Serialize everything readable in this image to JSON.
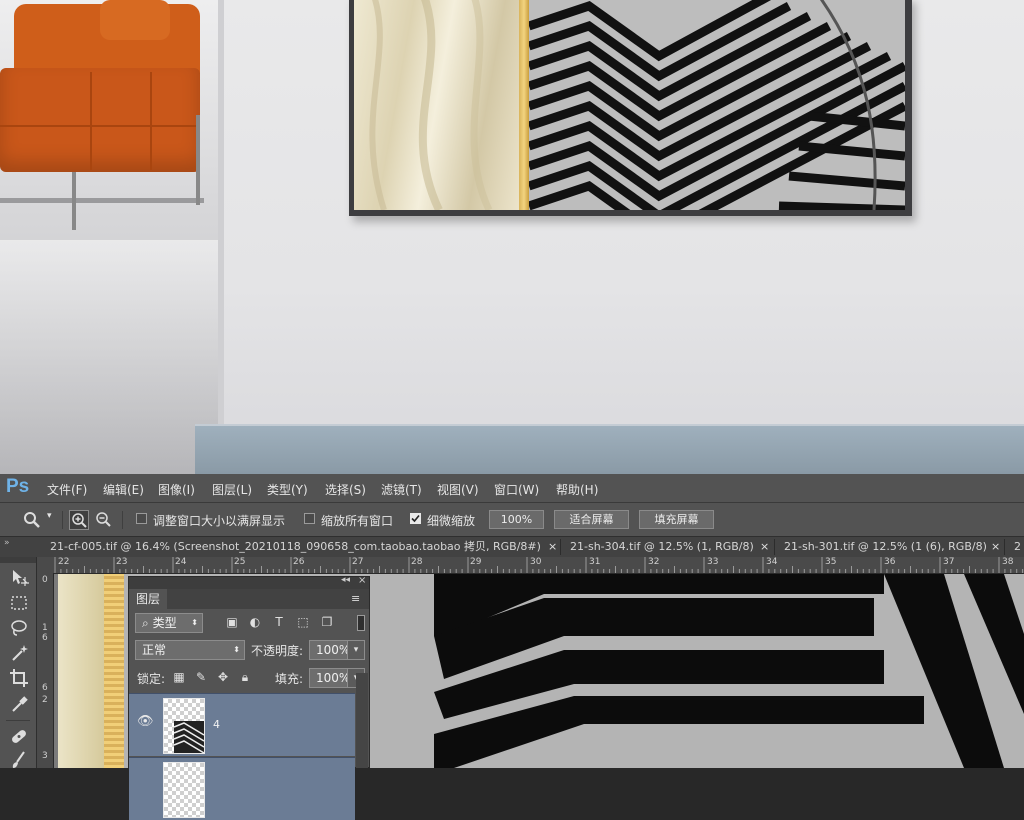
{
  "app": {
    "logo": "Ps"
  },
  "menu": [
    "文件(F)",
    "编辑(E)",
    "图像(I)",
    "图层(L)",
    "类型(Y)",
    "选择(S)",
    "滤镜(T)",
    "视图(V)",
    "窗口(W)",
    "帮助(H)"
  ],
  "options": {
    "resize_windows_label": "调整窗口大小以满屏显示",
    "zoom_all_windows_label": "缩放所有窗口",
    "scrubby_zoom_label": "细微缩放",
    "scrubby_zoom_checked": true,
    "zoom_100_label": "100%",
    "fit_screen_label": "适合屏幕",
    "fill_screen_label": "填充屏幕"
  },
  "tabs": [
    {
      "label": "21-cf-005.tif @ 16.4% (Screenshot_20210118_090658_com.taobao.taobao 拷贝, RGB/8#) *",
      "active": false
    },
    {
      "label": "21-sh-304.tif @ 12.5% (1, RGB/8)",
      "active": false
    },
    {
      "label": "21-sh-301.tif @ 12.5% (1 (6), RGB/8)",
      "active": false
    },
    {
      "label": "2",
      "active": false
    }
  ],
  "ruler": {
    "top": [
      "22",
      "23",
      "24",
      "25",
      "26",
      "27",
      "28",
      "29",
      "30",
      "31",
      "32",
      "33",
      "34",
      "35",
      "36",
      "37",
      "38"
    ],
    "left": [
      "0",
      "1",
      "6",
      "2",
      "6",
      "3"
    ]
  },
  "tools": [
    "move-tool",
    "marquee-tool",
    "lasso-tool",
    "magic-wand-tool",
    "crop-tool",
    "eyedropper-tool",
    "healing-brush-tool",
    "brush-tool"
  ],
  "layers_panel": {
    "tab_label": "图层",
    "filter_label": "类型",
    "blend_mode": "正常",
    "opacity_label": "不透明度:",
    "opacity_value": "100%",
    "lock_label": "锁定:",
    "fill_label": "填充:",
    "fill_value": "100%",
    "layers": [
      {
        "name": "4",
        "visible": true,
        "selected": true
      },
      {
        "name": "",
        "visible": true,
        "selected": false
      }
    ]
  }
}
